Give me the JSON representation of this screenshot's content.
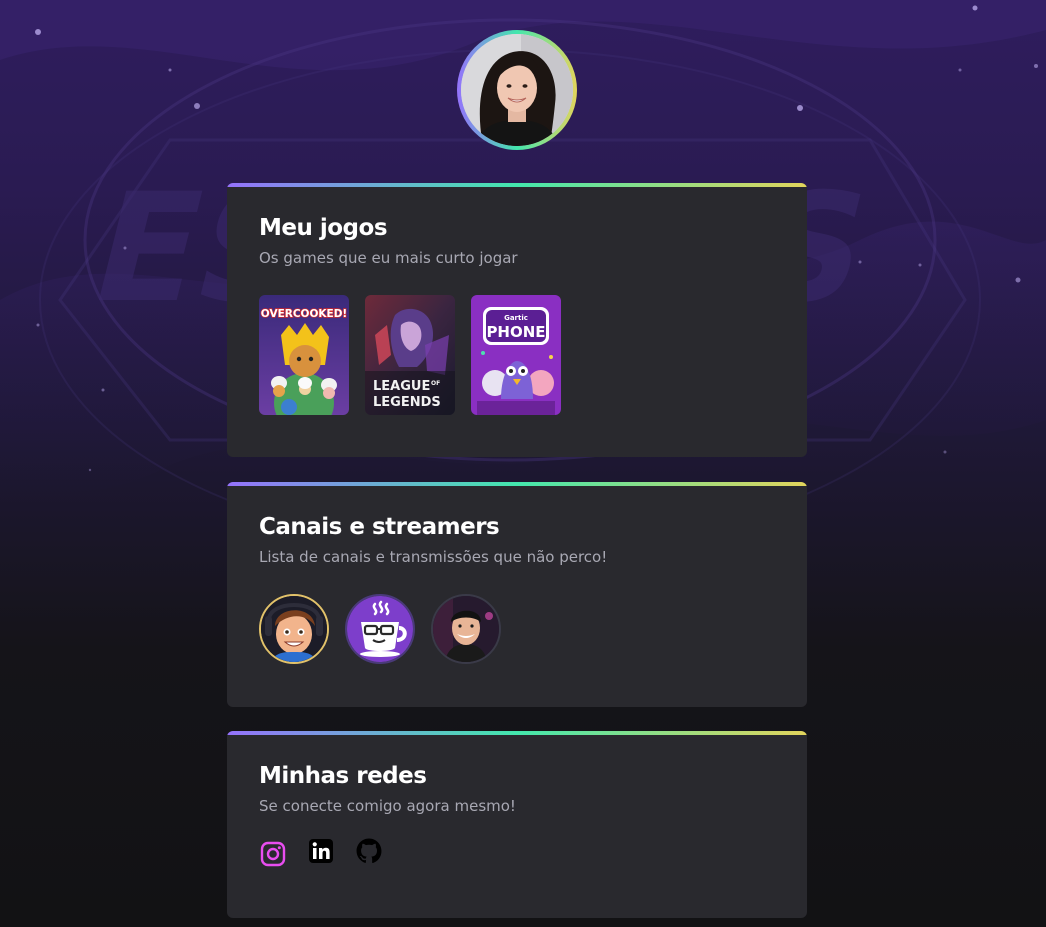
{
  "profile": {
    "avatar_alt": "Foto de perfil"
  },
  "background": {
    "logo_text": "ESPORTS"
  },
  "games_section": {
    "title": "Meu jogos",
    "subtitle": "Os games que eu mais curto jogar",
    "games": [
      {
        "name": "OVERCOOKED!",
        "icon": "overcooked-cover"
      },
      {
        "name_line1": "LEAGUE",
        "name_of": "OF",
        "name_line2": "LEGENDS",
        "icon": "league-of-legends-cover"
      },
      {
        "name_top": "Gartic",
        "name": "PHONE",
        "icon": "gartic-phone-cover"
      }
    ]
  },
  "streamers_section": {
    "title": "Canais e streamers",
    "subtitle": "Lista de canais e transmissões que não perco!",
    "streamers": [
      {
        "icon": "cartoon-streamer-avatar"
      },
      {
        "icon": "coffee-glasses-avatar"
      },
      {
        "icon": "streamer-photo-avatar"
      }
    ]
  },
  "social_section": {
    "title": "Minhas redes",
    "subtitle": "Se conecte comigo agora mesmo!",
    "links": [
      {
        "icon": "instagram-icon",
        "color": "#e84df0"
      },
      {
        "icon": "linkedin-icon",
        "color": "#000000"
      },
      {
        "icon": "github-icon",
        "color": "#000000"
      }
    ]
  },
  "colors": {
    "accent_gradient": [
      "#9572fc",
      "#43e7ad",
      "#e2d45c"
    ],
    "card_bg": "#29292e",
    "title": "#ffffff",
    "subtitle": "#a8a8b3"
  }
}
